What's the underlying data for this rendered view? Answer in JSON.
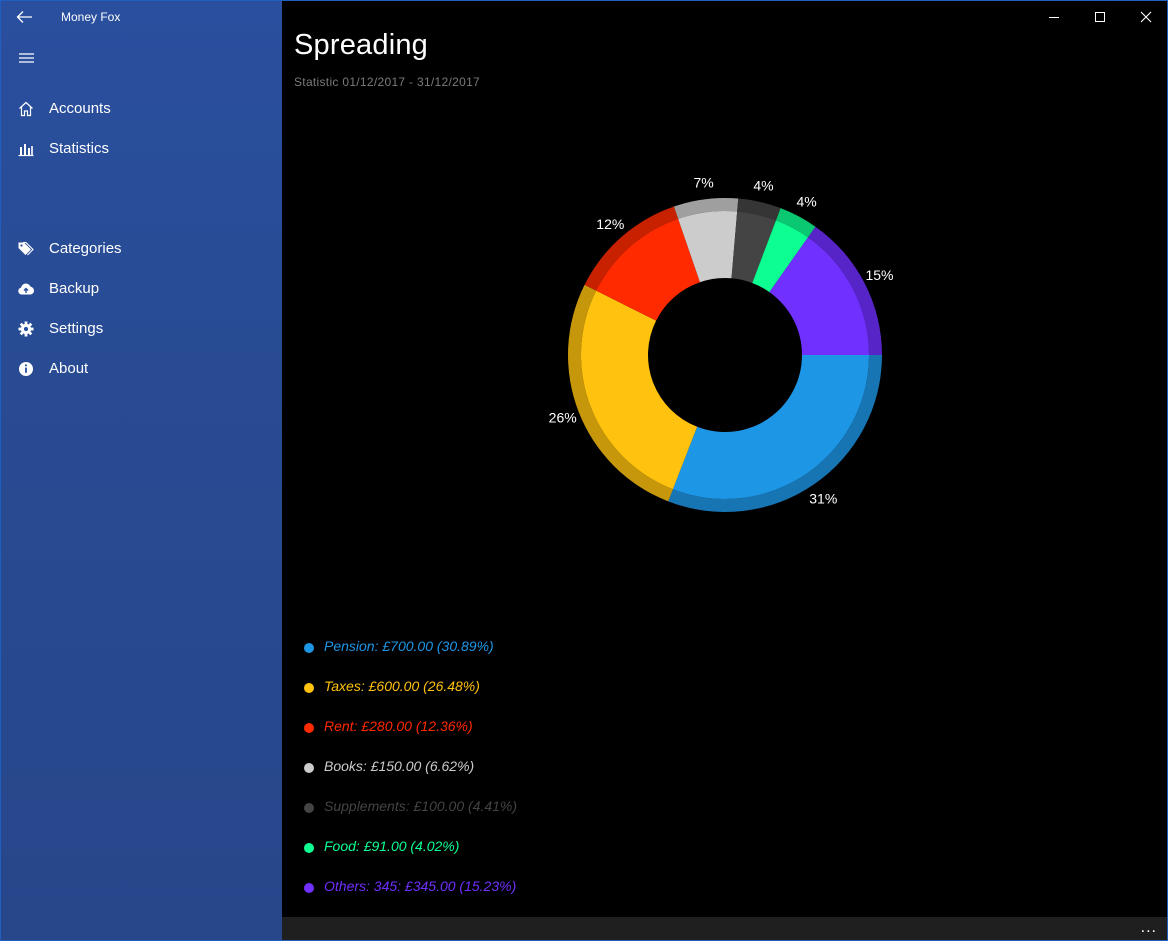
{
  "app": {
    "title": "Money Fox"
  },
  "sidebar": {
    "items": [
      {
        "label": "Accounts",
        "icon": "home-icon"
      },
      {
        "label": "Statistics",
        "icon": "bar-chart-icon"
      },
      {
        "label": "Categories",
        "icon": "tag-icon"
      },
      {
        "label": "Backup",
        "icon": "cloud-upload-icon"
      },
      {
        "label": "Settings",
        "icon": "gear-icon"
      },
      {
        "label": "About",
        "icon": "info-icon"
      }
    ]
  },
  "page": {
    "title": "Spreading",
    "subtitle": "Statistic 01/12/2017 - 31/12/2017"
  },
  "chart_data": {
    "type": "pie",
    "donut": true,
    "slices": [
      {
        "label": "Pension",
        "value": 700.0,
        "percent": 30.89,
        "display_pct": "31%",
        "color": "#1e96e6"
      },
      {
        "label": "Taxes",
        "value": 600.0,
        "percent": 26.48,
        "display_pct": "26%",
        "color": "#ffc20e"
      },
      {
        "label": "Rent",
        "value": 280.0,
        "percent": 12.36,
        "display_pct": "12%",
        "color": "#ff2a00"
      },
      {
        "label": "Books",
        "value": 150.0,
        "percent": 6.62,
        "display_pct": "7%",
        "color": "#cccccc"
      },
      {
        "label": "Supplements",
        "value": 100.0,
        "percent": 4.41,
        "display_pct": "4%",
        "color": "#444444"
      },
      {
        "label": "Food",
        "value": 91.0,
        "percent": 4.02,
        "display_pct": "4%",
        "color": "#0dff92"
      },
      {
        "label": "Others: 345",
        "value": 345.0,
        "percent": 15.23,
        "display_pct": "15%",
        "color": "#7030ff"
      }
    ]
  },
  "legend": [
    {
      "text": "Pension: £700.00 (30.89%)",
      "color": "#1e96e6"
    },
    {
      "text": "Taxes: £600.00 (26.48%)",
      "color": "#ffc20e"
    },
    {
      "text": "Rent: £280.00 (12.36%)",
      "color": "#ff2a00"
    },
    {
      "text": "Books: £150.00 (6.62%)",
      "color": "#cccccc"
    },
    {
      "text": "Supplements: £100.00 (4.41%)",
      "color": "#444444"
    },
    {
      "text": "Food: £91.00 (4.02%)",
      "color": "#0dff92"
    },
    {
      "text": "Others: 345: £345.00 (15.23%)",
      "color": "#7030ff"
    }
  ],
  "bottom_bar": {
    "more_label": "..."
  }
}
